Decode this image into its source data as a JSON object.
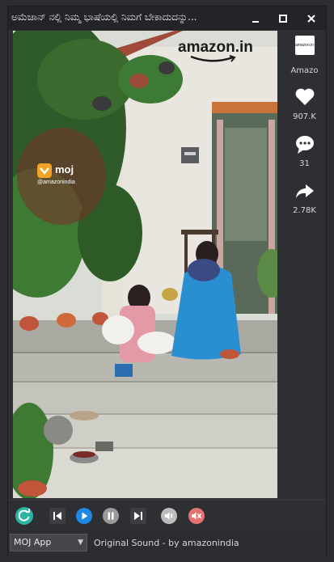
{
  "window": {
    "title": "ಅಮೆಜಾನ್ ನಲ್ಲಿ ನಿಮ್ಮ ಭಾಷೆಯಲ್ಲಿ ನಿಮಗೆ ಬೇಕಾದುದನ್ನು...",
    "controls": [
      "minimize-icon",
      "maximize-icon",
      "close-icon"
    ]
  },
  "video": {
    "brand_watermark": "amazon.in",
    "moj_label": "moj",
    "moj_handle": "@amazonindia"
  },
  "sidebar": {
    "channel_logo_text": "amazon.in",
    "channel_name": "Amazo",
    "likes": "907.K",
    "comments": "31",
    "shares": "2.78K"
  },
  "player": {
    "buttons": [
      "refresh-icon",
      "skip-back-icon",
      "play-icon",
      "pause-icon",
      "skip-forward-icon",
      "volume-icon",
      "mute-icon"
    ],
    "accent_color": "#1e88e5",
    "refresh_color": "#26a69a",
    "mute_color": "#e57373"
  },
  "footer": {
    "source_select": "MOJ App",
    "sound_text": "Original Sound - by amazonindia"
  }
}
